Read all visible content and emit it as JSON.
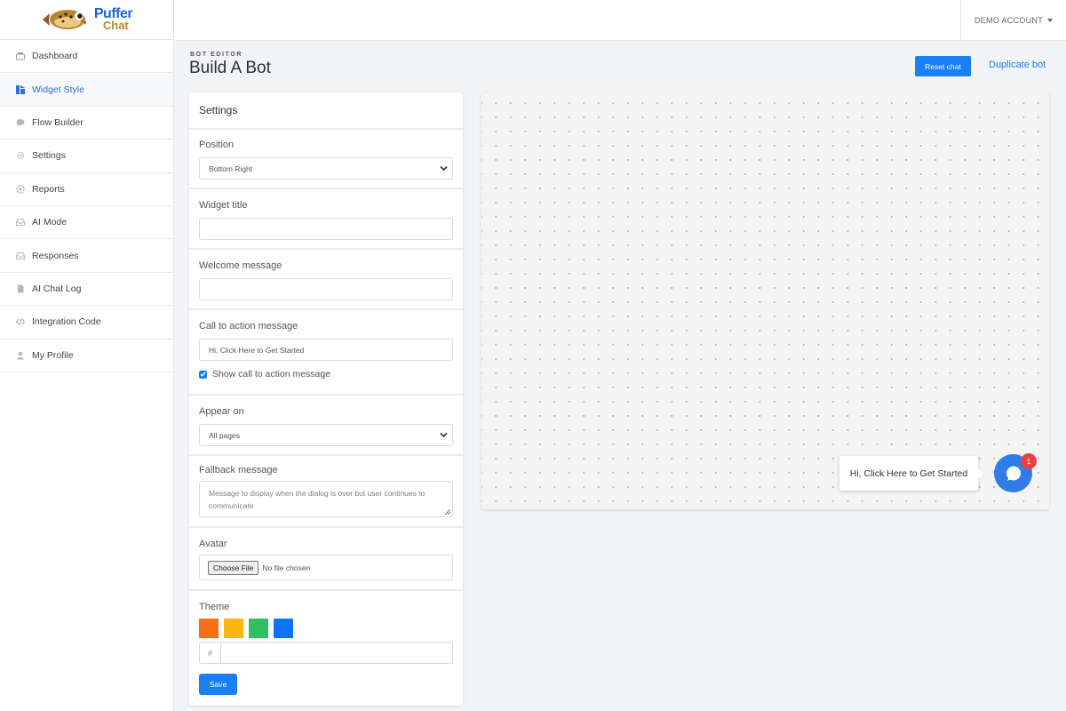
{
  "brand": {
    "line1": "Puffer",
    "line2": "Chat"
  },
  "sidebar": {
    "items": [
      {
        "label": "Dashboard",
        "icon": "dashboard-icon"
      },
      {
        "label": "Widget Style",
        "icon": "widget-style-icon",
        "active": true
      },
      {
        "label": "Flow Builder",
        "icon": "chat-bubble-icon"
      },
      {
        "label": "Settings",
        "icon": "gear-icon"
      },
      {
        "label": "Reports",
        "icon": "reports-icon"
      },
      {
        "label": "AI Mode",
        "icon": "inbox-icon"
      },
      {
        "label": "Responses",
        "icon": "inbox-icon"
      },
      {
        "label": "AI Chat Log",
        "icon": "document-icon"
      },
      {
        "label": "Integration Code",
        "icon": "code-icon"
      },
      {
        "label": "My Profile",
        "icon": "user-icon"
      }
    ]
  },
  "topbar": {
    "account": "DEMO ACCOUNT"
  },
  "header": {
    "eyebrow": "BOT EDITOR",
    "title": "Build A Bot",
    "reset_label": "Reset chat",
    "duplicate_label": "Duplicate bot"
  },
  "settings": {
    "title": "Settings",
    "position": {
      "label": "Position",
      "value": "Bottom Right"
    },
    "widget_title": {
      "label": "Widget title",
      "value": ""
    },
    "welcome": {
      "label": "Welcome message",
      "value": ""
    },
    "cta": {
      "label": "Call to action message",
      "value": "Hi, Click Here to Get Started",
      "checkbox_label": "Show call to action message",
      "checked": true
    },
    "appear_on": {
      "label": "Appear on",
      "value": "All pages"
    },
    "fallback": {
      "label": "Fallback message",
      "placeholder": "Message to display when the dialog is over but user continues to communicate"
    },
    "avatar": {
      "label": "Avatar",
      "button": "Choose File",
      "status": "No file chosen"
    },
    "theme": {
      "label": "Theme",
      "colors": [
        "#f57014",
        "#fbb612",
        "#2fbe60",
        "#0f73f6"
      ],
      "hex_prefix": "#",
      "hex_value": ""
    },
    "save_label": "Save"
  },
  "preview": {
    "cta_text": "Hi, Click Here to Get Started",
    "badge_count": "1",
    "launcher_color": "#2f7ce8"
  }
}
